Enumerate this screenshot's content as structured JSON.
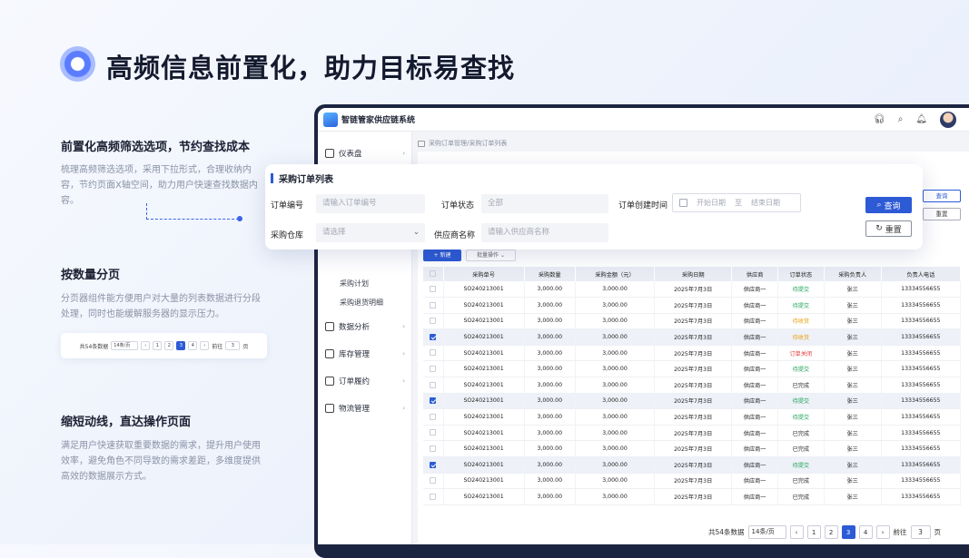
{
  "hero": {
    "title": "高频信息前置化，助力目标易查找"
  },
  "features": [
    {
      "title": "前置化高频筛选选项，节约查找成本",
      "desc": "梳理高频筛选选项，采用下拉形式，合理收纳内容，节约页面X轴空间，助力用户快速查找数据内容。"
    },
    {
      "title": "按数量分页",
      "desc": "分页器组件能方便用户对大量的列表数据进行分段处理，同时也能缓解服务器的显示压力。"
    },
    {
      "title": "缩短动线，直达操作页面",
      "desc": "满足用户快速获取重要数据的需求，提升用户使用效率，避免角色不同导致的需求差距，多维度提供高效的数据展示方式。"
    }
  ],
  "mini_pager": {
    "total": "共54条数据",
    "size": "14条/页",
    "pages": [
      "1",
      "2",
      "3",
      "4"
    ],
    "active": "3",
    "goto": "前往",
    "goto_val": "3",
    "page_unit": "页"
  },
  "app": {
    "title": "智链管家供应链系统",
    "breadcrumb": "采购订单管理/采购订单列表",
    "sidebar": [
      {
        "label": "仪表盘"
      },
      {
        "label": "数据分析"
      },
      {
        "label": "库存管理"
      },
      {
        "label": "订单履约"
      },
      {
        "label": "物流管理"
      }
    ],
    "subitems": [
      "采购计划",
      "采购退货明细"
    ],
    "btn_new": "+ 新建",
    "btn_batch": "批量操作 ⌄",
    "btn_query_small": "查询",
    "btn_reset_small": "重置"
  },
  "filter": {
    "title": "采购订单列表",
    "order_no_label": "订单编号",
    "order_no_placeholder": "请输入订单编号",
    "status_label": "订单状态",
    "status_value": "全部",
    "created_label": "订单创建时间",
    "start": "开始日期",
    "to": "至",
    "end": "结束日期",
    "warehouse_label": "采购仓库",
    "warehouse_placeholder": "请选择",
    "supplier_label": "供应商名称",
    "supplier_placeholder": "请输入供应商名称",
    "query": "查询",
    "reset": "重置"
  },
  "table": {
    "headers": [
      "采购单号",
      "采购数量",
      "采购金额（元）",
      "采购日期",
      "供应商",
      "订单状态",
      "采购负责人",
      "负责人电话"
    ],
    "rows": [
      {
        "checked": false,
        "cells": [
          "SO240213001",
          "3,000.00",
          "3,000.00",
          "2025年7月3日",
          "供应商一",
          "待提交",
          "张三",
          "13334556655"
        ],
        "status": "pending"
      },
      {
        "checked": false,
        "cells": [
          "SO240213001",
          "3,000.00",
          "3,000.00",
          "2025年7月3日",
          "供应商一",
          "待提交",
          "张三",
          "13334556655"
        ],
        "status": "pending"
      },
      {
        "checked": false,
        "cells": [
          "SO240213001",
          "3,000.00",
          "3,000.00",
          "2025年7月3日",
          "供应商一",
          "待收货",
          "张三",
          "13334556655"
        ],
        "status": "shipped"
      },
      {
        "checked": true,
        "cells": [
          "SO240213001",
          "3,000.00",
          "3,000.00",
          "2025年7月3日",
          "供应商一",
          "待收货",
          "张三",
          "13334556655"
        ],
        "status": "shipped"
      },
      {
        "checked": false,
        "cells": [
          "SO240213001",
          "3,000.00",
          "3,000.00",
          "2025年7月3日",
          "供应商一",
          "订单关闭",
          "张三",
          "13334556655"
        ],
        "status": "closed"
      },
      {
        "checked": false,
        "cells": [
          "SO240213001",
          "3,000.00",
          "3,000.00",
          "2025年7月3日",
          "供应商一",
          "待提交",
          "张三",
          "13334556655"
        ],
        "status": "pending"
      },
      {
        "checked": false,
        "cells": [
          "SO240213001",
          "3,000.00",
          "3,000.00",
          "2025年7月3日",
          "供应商一",
          "已完成",
          "张三",
          "13334556655"
        ],
        "status": "done"
      },
      {
        "checked": true,
        "cells": [
          "SO240213001",
          "3,000.00",
          "3,000.00",
          "2025年7月3日",
          "供应商一",
          "待提交",
          "张三",
          "13334556655"
        ],
        "status": "pending"
      },
      {
        "checked": false,
        "cells": [
          "SO240213001",
          "3,000.00",
          "3,000.00",
          "2025年7月3日",
          "供应商一",
          "待提交",
          "张三",
          "13334556655"
        ],
        "status": "pending"
      },
      {
        "checked": false,
        "cells": [
          "SO240213001",
          "3,000.00",
          "3,000.00",
          "2025年7月3日",
          "供应商一",
          "已完成",
          "张三",
          "13334556655"
        ],
        "status": "done"
      },
      {
        "checked": false,
        "cells": [
          "SO240213001",
          "3,000.00",
          "3,000.00",
          "2025年7月3日",
          "供应商一",
          "已完成",
          "张三",
          "13334556655"
        ],
        "status": "done"
      },
      {
        "checked": true,
        "cells": [
          "SO240213001",
          "3,000.00",
          "3,000.00",
          "2025年7月3日",
          "供应商一",
          "待提交",
          "张三",
          "13334556655"
        ],
        "status": "pending"
      },
      {
        "checked": false,
        "cells": [
          "SO240213001",
          "3,000.00",
          "3,000.00",
          "2025年7月3日",
          "供应商一",
          "已完成",
          "张三",
          "13334556655"
        ],
        "status": "done"
      },
      {
        "checked": false,
        "cells": [
          "SO240213001",
          "3,000.00",
          "3,000.00",
          "2025年7月3日",
          "供应商一",
          "已完成",
          "张三",
          "13334556655"
        ],
        "status": "done"
      }
    ]
  },
  "pager": {
    "total": "共54条数据",
    "size": "14条/页",
    "pages": [
      "1",
      "2",
      "3",
      "4"
    ],
    "active": "3",
    "goto": "前往",
    "goto_val": "3",
    "page_unit": "页"
  },
  "colors": {
    "accent": "#2d5bd6",
    "pending": "#22a45a",
    "shipped": "#e8a317",
    "closed": "#e33d3d"
  }
}
